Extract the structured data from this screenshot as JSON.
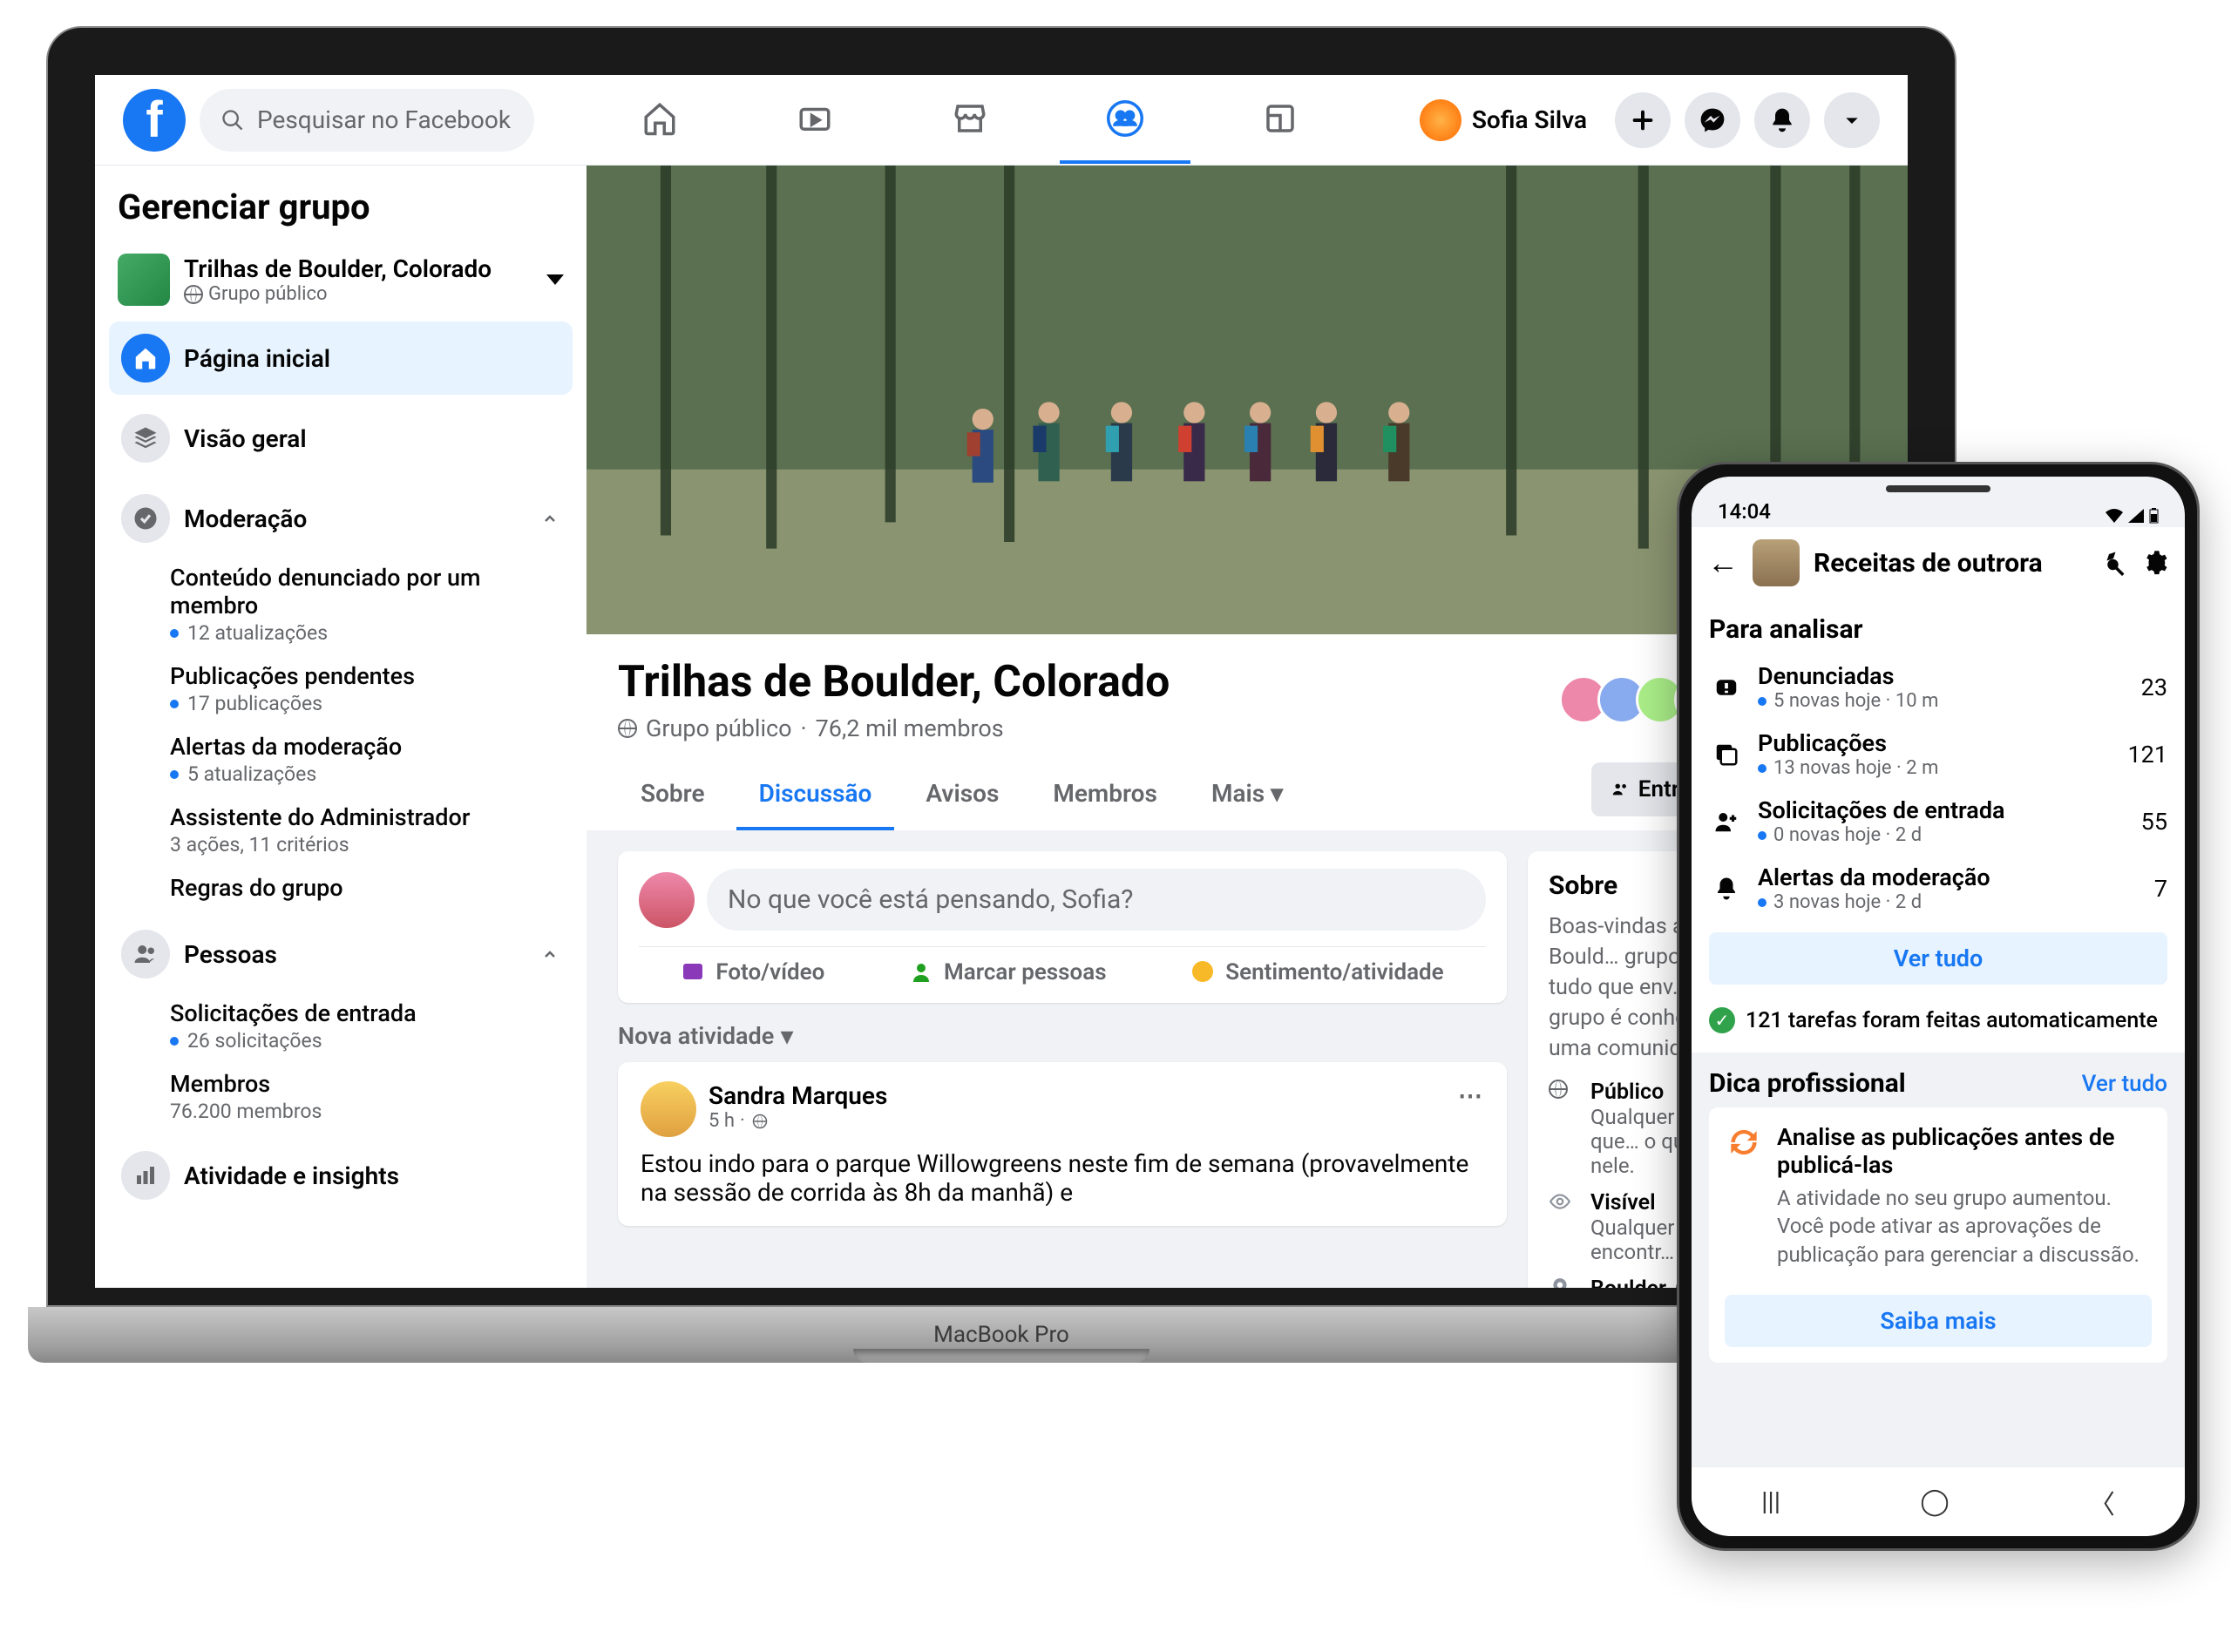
{
  "laptop_label": "MacBook Pro",
  "topbar": {
    "search_placeholder": "Pesquisar no Facebook",
    "user_name": "Sofia Silva"
  },
  "sidebar": {
    "title": "Gerenciar grupo",
    "group": {
      "name": "Trilhas de Boulder, Colorado",
      "type": "Grupo público"
    },
    "home": "Página inicial",
    "overview": "Visão geral",
    "moderation": {
      "label": "Moderação",
      "items": [
        {
          "t": "Conteúdo denunciado por um membro",
          "s": "12 atualizações"
        },
        {
          "t": "Publicações pendentes",
          "s": "17 publicações"
        },
        {
          "t": "Alertas da moderação",
          "s": "5 atualizações"
        },
        {
          "t": "Assistente do Administrador",
          "s": "3 ações, 11 critérios",
          "nodot": true
        },
        {
          "t": "Regras do grupo",
          "s": "",
          "nodot": true
        }
      ]
    },
    "people": {
      "label": "Pessoas",
      "items": [
        {
          "t": "Solicitações de entrada",
          "s": "26 solicitações"
        },
        {
          "t": "Membros",
          "s": "76.200 membros",
          "nodot": true
        }
      ]
    },
    "insights": "Atividade e insights"
  },
  "group": {
    "title": "Trilhas de Boulder, Colorado",
    "visibility": "Grupo público",
    "member_count": "76,2 mil membros",
    "tabs": [
      "Sobre",
      "Discussão",
      "Avisos",
      "Membros",
      "Mais"
    ],
    "joined_label": "Entrou"
  },
  "composer": {
    "placeholder": "No que você está pensando, Sofia?",
    "actions": [
      "Foto/vídeo",
      "Marcar pessoas",
      "Sentimento/atividade"
    ]
  },
  "feed": {
    "section_label": "Nova atividade",
    "post": {
      "author": "Sandra Marques",
      "meta": "5 h",
      "body": "Estou indo para o parque Willowgreens neste fim de semana (provavelmente na sessão de corrida às 8h da manhã) e"
    }
  },
  "about": {
    "title": "Sobre",
    "desc": "Boas-vindas ao Trilheiros de Bould… grupo apaixonado por tudo que env… objetivo deste grupo é conhecer c… construir uma comunidade de amig…",
    "rows": [
      {
        "t": "Público",
        "s": "Qualquer pessoa pode ver que… o que é publicado nele."
      },
      {
        "t": "Visível",
        "s": "Qualquer pessoa pode encontr…"
      },
      {
        "t": "Boulder, Colorado · São Franc…",
        "s": ""
      }
    ]
  },
  "phone": {
    "time": "14:04",
    "header_title": "Receitas de outrora",
    "review": {
      "title": "Para analisar",
      "rows": [
        {
          "title": "Denunciadas",
          "sub": "5 novas hoje · 10 m",
          "count": "23"
        },
        {
          "title": "Publicações",
          "sub": "13 novas hoje · 2 m",
          "count": "121"
        },
        {
          "title": "Solicitações de entrada",
          "sub": "0 novas hoje · 2 d",
          "count": "55"
        },
        {
          "title": "Alertas da moderação",
          "sub": "3 novas hoje · 2 d",
          "count": "7"
        }
      ],
      "see_all": "Ver tudo",
      "auto_done": "121 tarefas foram feitas automaticamente"
    },
    "tip": {
      "heading": "Dica profissional",
      "see_all": "Ver tudo",
      "title": "Analise as publicações antes de publicá-las",
      "desc": "A atividade no seu grupo aumentou. Você pode ativar as aprovações de publicação para gerenciar a discussão.",
      "cta": "Saiba mais"
    }
  }
}
